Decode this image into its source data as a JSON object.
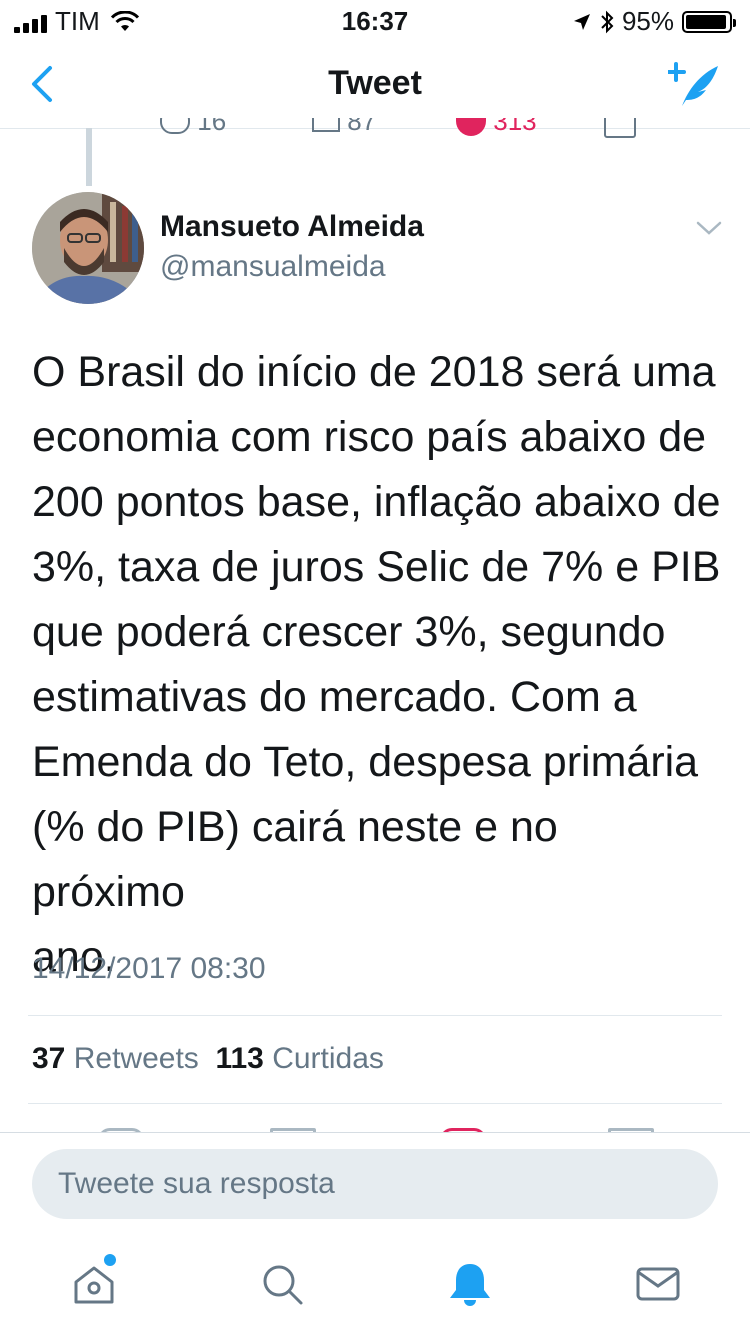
{
  "status_bar": {
    "carrier": "TIM",
    "time": "16:37",
    "battery": "95%",
    "battery_level": 0.95
  },
  "nav": {
    "title": "Tweet",
    "back_icon": "chevron-left-icon",
    "compose_icon": "compose-tweet-icon"
  },
  "previous_tweet_actions": {
    "replies": "16",
    "retweets": "87",
    "likes": "313"
  },
  "tweet": {
    "author_name": "Mansueto Almeida",
    "author_handle": "@mansualmeida",
    "text": "O Brasil do início de 2018 será uma\neconomia com risco país abaixo de\n200 pontos base, inflação abaixo de\n3%, taxa de juros Selic de 7% e PIB\nque poderá crescer  3%, segundo\nestimativas do mercado. Com a\nEmenda do Teto, despesa primária\n(% do PIB) cairá neste e no próximo\nano.",
    "timestamp": "14/12/2017 08:30",
    "retweets_count": "37",
    "retweets_label": "Retweets",
    "likes_count": "113",
    "likes_label": "Curtidas"
  },
  "reply_bar": {
    "placeholder": "Tweete sua resposta"
  },
  "tabbar": {
    "items": [
      "home-icon",
      "search-icon",
      "notifications-icon",
      "messages-icon"
    ],
    "active": "notifications-icon"
  },
  "colors": {
    "accent": "#1da1f2",
    "like": "#e0245e",
    "secondary_text": "#657786",
    "divider": "#e1e8ed"
  }
}
